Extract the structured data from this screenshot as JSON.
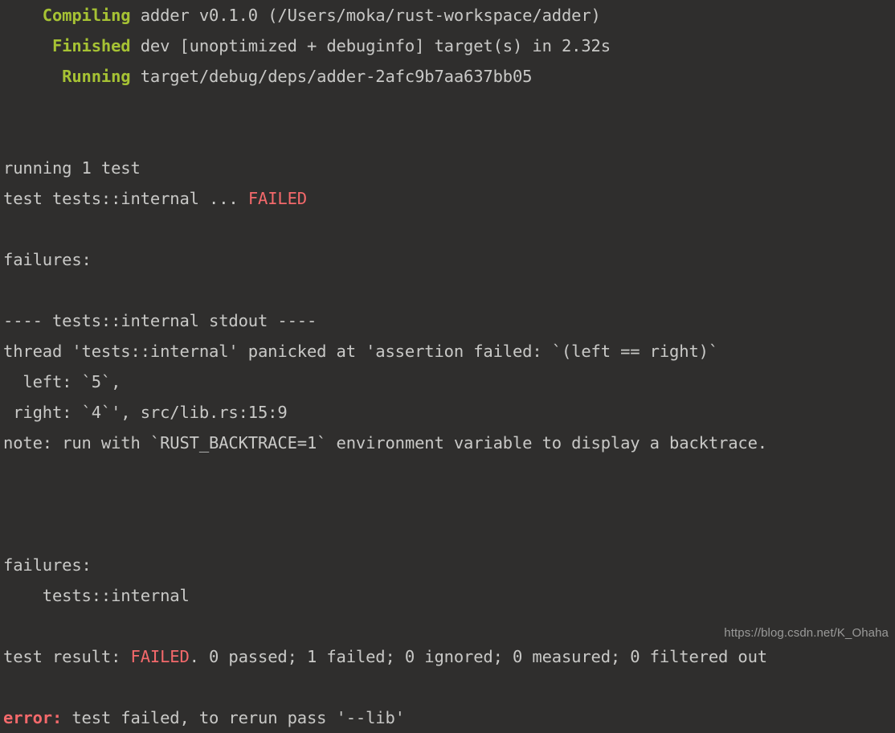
{
  "terminal": {
    "background_color": "#2f2e2d",
    "foreground_color": "#c9c9c7",
    "status_color": "#a6c234",
    "error_color": "#f4696b",
    "lines": [
      {
        "id": "compiling",
        "segments": [
          {
            "cls": "status",
            "text": "    Compiling"
          },
          {
            "cls": "plain",
            "text": " adder v0.1.0 (/Users/moka/rust-workspace/adder)"
          }
        ]
      },
      {
        "id": "finished",
        "segments": [
          {
            "cls": "status",
            "text": "     Finished"
          },
          {
            "cls": "plain",
            "text": " dev [unoptimized + debuginfo] target(s) in 2.32s"
          }
        ]
      },
      {
        "id": "running-binary",
        "segments": [
          {
            "cls": "status",
            "text": "      Running"
          },
          {
            "cls": "plain",
            "text": " target/debug/deps/adder-2afc9b7aa637bb05"
          }
        ]
      },
      {
        "id": "blank-1",
        "segments": []
      },
      {
        "id": "blank-2",
        "segments": []
      },
      {
        "id": "running-count",
        "segments": [
          {
            "cls": "plain",
            "text": "running 1 test"
          }
        ]
      },
      {
        "id": "test-result-line",
        "segments": [
          {
            "cls": "plain",
            "text": "test tests::internal ... "
          },
          {
            "cls": "fail",
            "text": "FAILED"
          }
        ]
      },
      {
        "id": "blank-3",
        "segments": []
      },
      {
        "id": "failures-heading-1",
        "segments": [
          {
            "cls": "plain",
            "text": "failures:"
          }
        ]
      },
      {
        "id": "blank-4",
        "segments": []
      },
      {
        "id": "stdout-header",
        "segments": [
          {
            "cls": "plain",
            "text": "---- tests::internal stdout ----"
          }
        ]
      },
      {
        "id": "panic-line",
        "segments": [
          {
            "cls": "plain",
            "text": "thread 'tests::internal' panicked at 'assertion failed: `(left == right)`"
          }
        ]
      },
      {
        "id": "left-value",
        "segments": [
          {
            "cls": "plain",
            "text": "  left: `5`,"
          }
        ]
      },
      {
        "id": "right-value",
        "segments": [
          {
            "cls": "plain",
            "text": " right: `4`', src/lib.rs:15:9"
          }
        ]
      },
      {
        "id": "backtrace-note",
        "segments": [
          {
            "cls": "plain",
            "text": "note: run with `RUST_BACKTRACE=1` environment variable to display a backtrace."
          }
        ]
      },
      {
        "id": "blank-5",
        "segments": []
      },
      {
        "id": "blank-6",
        "segments": []
      },
      {
        "id": "blank-7",
        "segments": []
      },
      {
        "id": "failures-heading-2",
        "segments": [
          {
            "cls": "plain",
            "text": "failures:"
          }
        ]
      },
      {
        "id": "failed-test-name",
        "segments": [
          {
            "cls": "plain",
            "text": "    tests::internal"
          }
        ]
      },
      {
        "id": "blank-8",
        "segments": []
      },
      {
        "id": "summary-line",
        "segments": [
          {
            "cls": "plain",
            "text": "test result: "
          },
          {
            "cls": "fail",
            "text": "FAILED"
          },
          {
            "cls": "plain",
            "text": ". 0 passed; 1 failed; 0 ignored; 0 measured; 0 filtered out"
          }
        ]
      },
      {
        "id": "blank-9",
        "segments": []
      },
      {
        "id": "error-line",
        "segments": [
          {
            "cls": "errlabel",
            "text": "error:"
          },
          {
            "cls": "plain",
            "text": " test failed, to rerun pass '--lib'"
          }
        ]
      }
    ]
  },
  "watermark": {
    "text": "https://blog.csdn.net/K_Ohaha"
  }
}
